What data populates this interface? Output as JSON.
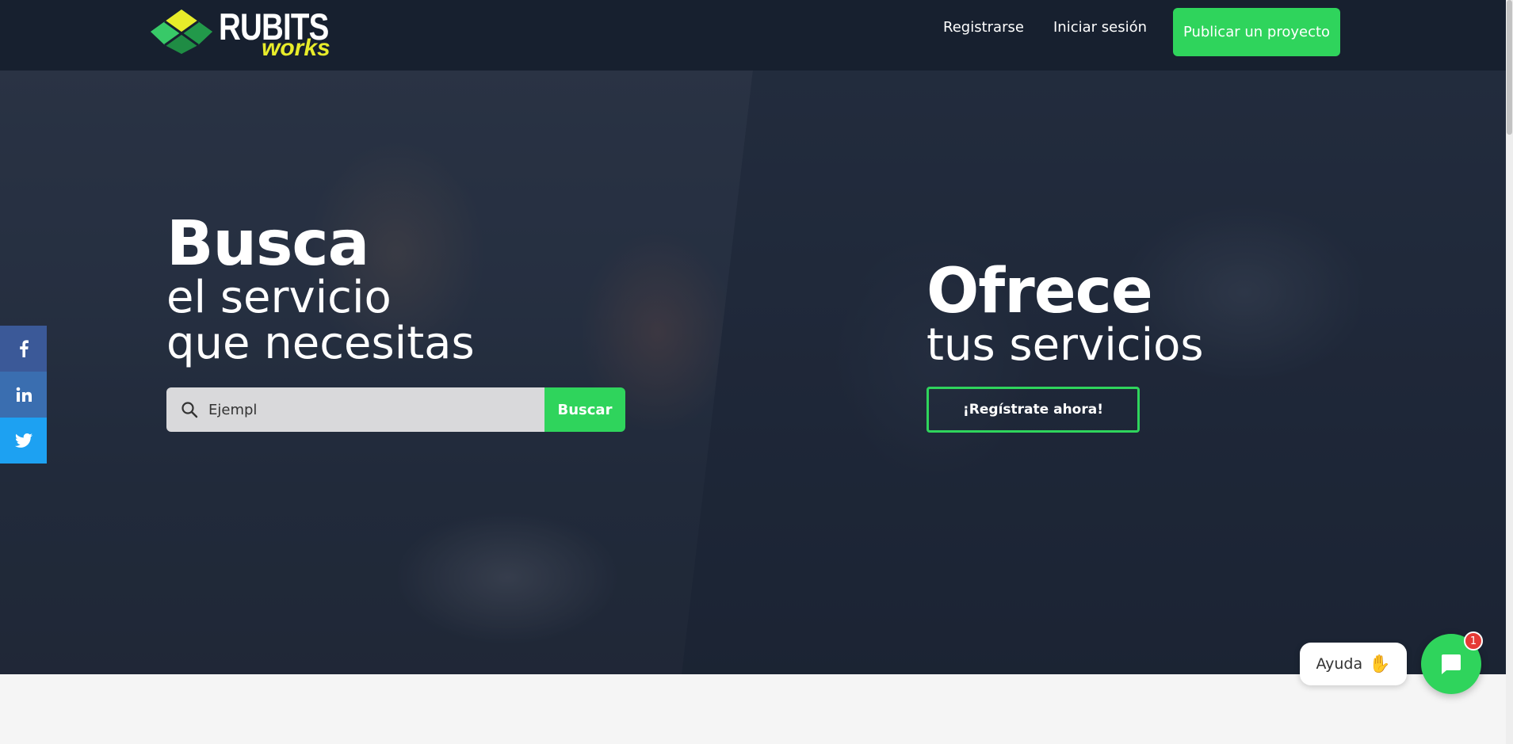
{
  "header": {
    "logo": {
      "brand": "RUBITS",
      "suffix": "works"
    },
    "nav": {
      "register": "Registrarse",
      "login": "Iniciar sesión"
    },
    "publish_label": "Publicar un proyecto"
  },
  "hero": {
    "left": {
      "title": "Busca",
      "subtitle_line1": "el servicio",
      "subtitle_line2": "que necesitas",
      "search": {
        "value": "Ejempl",
        "button_label": "Buscar"
      }
    },
    "right": {
      "title": "Ofrece",
      "subtitle": "tus servicios",
      "cta_label": "¡Regístrate ahora!"
    }
  },
  "social": {
    "items": [
      {
        "icon": "facebook-icon",
        "color": "#3b5998"
      },
      {
        "icon": "linkedin-icon",
        "color": "#3a6eb0"
      },
      {
        "icon": "twitter-icon",
        "color": "#1da1f2"
      }
    ]
  },
  "chat": {
    "help_label": "Ayuda",
    "help_icon": "waving-hand-icon",
    "badge_count": "1",
    "accent": "#2fd45c"
  },
  "colors": {
    "header": "#17202f",
    "accent": "#2fd45c",
    "logo_works": "#e8ec2a"
  }
}
